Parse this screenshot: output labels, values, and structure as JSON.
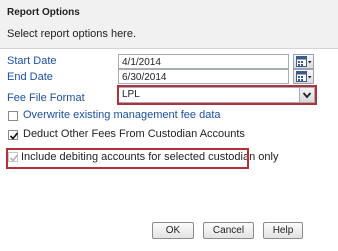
{
  "dialog": {
    "title": "Report Options",
    "instruction": "Select report options here."
  },
  "fields": {
    "start_date": {
      "label": "Start Date",
      "value": "4/1/2014"
    },
    "end_date": {
      "label": "End Date",
      "value": "6/30/2014"
    },
    "fee_file_format": {
      "label": "Fee File Format",
      "selected": "LPL"
    }
  },
  "options": {
    "overwrite": {
      "label": "Overwrite existing management fee data",
      "checked": false
    },
    "deduct": {
      "label": "Deduct Other Fees From Custodian Accounts",
      "checked": true
    },
    "include_debiting": {
      "label": "Include debiting accounts for selected custodian only",
      "checked": true,
      "disabled": true
    }
  },
  "buttons": {
    "ok": "OK",
    "cancel": "Cancel",
    "help": "Help"
  },
  "colors": {
    "label_blue": "#1c4f9c",
    "highlight_red": "#b0313b",
    "header_bg": "#f1f1f1"
  },
  "icons": {
    "calendar": "calendar-icon",
    "dropdown": "chevron-down-icon",
    "check": "checkmark-icon"
  }
}
